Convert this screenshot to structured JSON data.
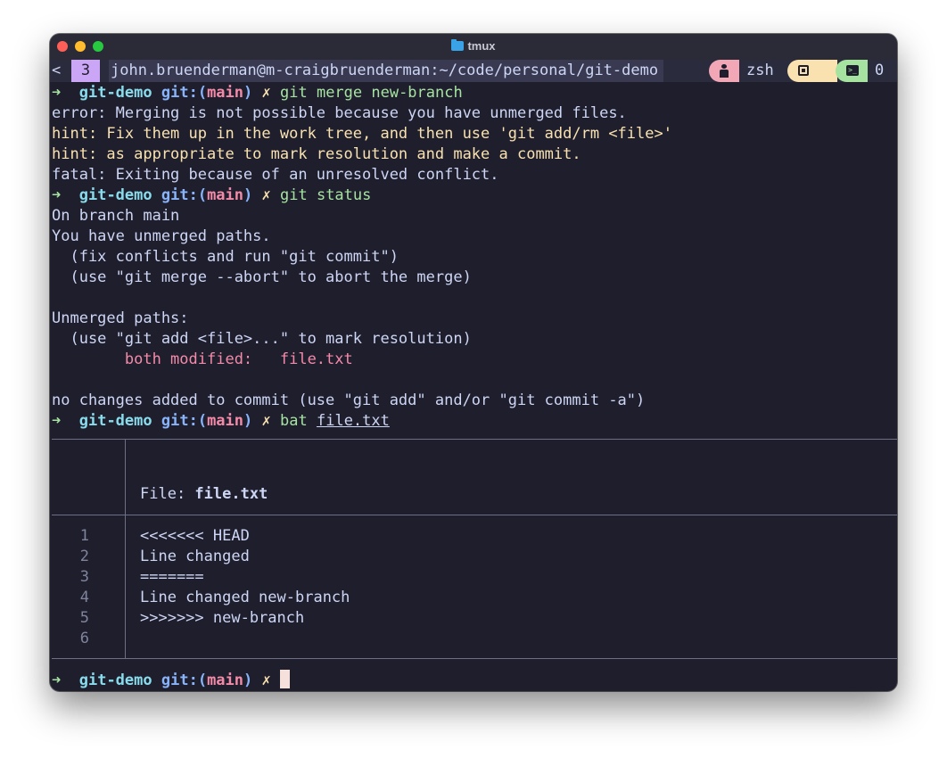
{
  "window": {
    "title": "tmux"
  },
  "statusbar": {
    "left_marker": "<",
    "window_index": "3",
    "host_path": "john.bruenderman@m-craigbruenderman:~/code/personal/git-demo",
    "shell": "zsh",
    "pane_count": "0",
    "term_icon_glyph": ">_"
  },
  "prompt": {
    "arrow": "➜",
    "dir": "git-demo",
    "git_label": "git:(",
    "branch": "main",
    "git_close": ")",
    "dirty": "✗"
  },
  "lines": {
    "cmd1": "git merge new-branch",
    "err1": "error: Merging is not possible because you have unmerged files.",
    "hint1": "hint: Fix them up in the work tree, and then use 'git add/rm <file>'",
    "hint2": "hint: as appropriate to mark resolution and make a commit.",
    "fatal1": "fatal: Exiting because of an unresolved conflict.",
    "cmd2": "git status",
    "st1": "On branch main",
    "st2": "You have unmerged paths.",
    "st3": "  (fix conflicts and run \"git commit\")",
    "st4": "  (use \"git merge --abort\" to abort the merge)",
    "st5": "Unmerged paths:",
    "st6": "  (use \"git add <file>...\" to mark resolution)",
    "st7": "        both modified:   file.txt",
    "st8": "no changes added to commit (use \"git add\" and/or \"git commit -a\")",
    "cmd3_prog": "bat",
    "cmd3_arg": "file.txt"
  },
  "bat": {
    "file_label": "File: ",
    "file_name": "file.txt",
    "rows": [
      {
        "num": "1",
        "text": "<<<<<<< HEAD"
      },
      {
        "num": "2",
        "text": "Line changed"
      },
      {
        "num": "3",
        "text": "======="
      },
      {
        "num": "4",
        "text": "Line changed new-branch"
      },
      {
        "num": "5",
        "text": ">>>>>>> new-branch"
      },
      {
        "num": "6",
        "text": ""
      }
    ]
  },
  "colors": {
    "background": "#1f1e2d",
    "prompt_arrow": "#a6e3a1",
    "dir": "#89dceb",
    "branch": "#f38ba8",
    "hint": "#f9e2af"
  }
}
